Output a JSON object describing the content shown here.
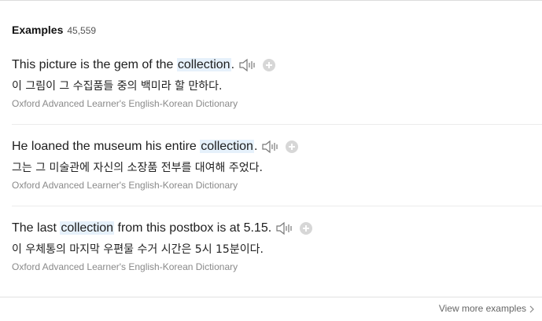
{
  "header": {
    "title": "Examples",
    "count": "45,559"
  },
  "examples": [
    {
      "en_before": "This picture is the gem of the ",
      "en_highlight": "collection",
      "en_after": ".",
      "ko": "이 그림이 그 수집품들 중의 백미라 할 만하다.",
      "source": "Oxford Advanced Learner's English-Korean Dictionary"
    },
    {
      "en_before": "He loaned the museum his entire ",
      "en_highlight": "collection",
      "en_after": ".",
      "ko": "그는 그 미술관에 자신의 소장품 전부를 대여해 주었다.",
      "source": "Oxford Advanced Learner's English-Korean Dictionary"
    },
    {
      "en_before": "The last ",
      "en_highlight": "collection",
      "en_after": " from this postbox is at 5.15.",
      "ko": "이 우체통의 마지막 우편물 수거 시간은 5시 15분이다.",
      "source": "Oxford Advanced Learner's English-Korean Dictionary"
    }
  ],
  "footer": {
    "view_more_label": "View more examples"
  },
  "icons": {
    "audio": "speaker-icon",
    "add": "plus-icon",
    "more": "chevron-right-icon"
  },
  "colors": {
    "highlight_bg": "#e6f1fb",
    "source_text": "#8a8a8a",
    "plus_bg": "#d7d7d7"
  }
}
